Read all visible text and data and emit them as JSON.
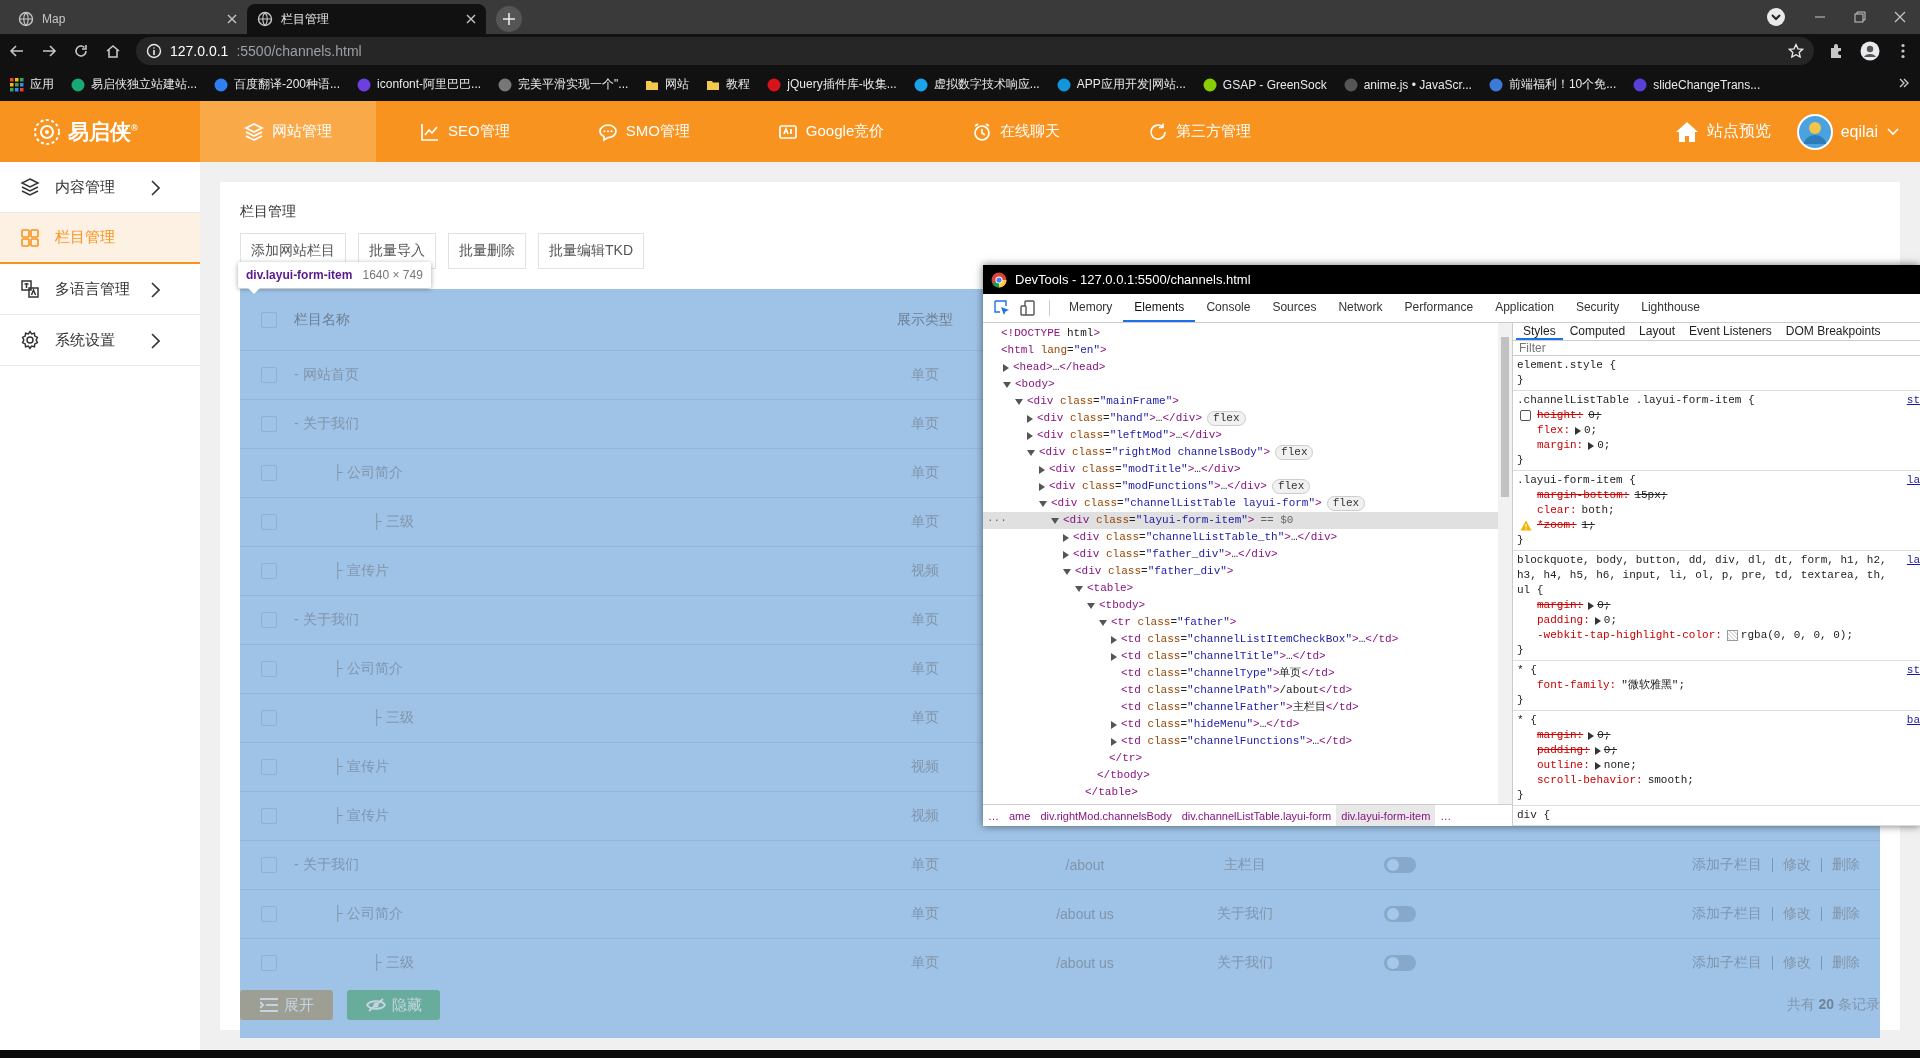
{
  "browser": {
    "tabs": [
      {
        "title": "Map",
        "selected": false
      },
      {
        "title": "栏目管理",
        "selected": true
      }
    ],
    "url_host": "127.0.0.1",
    "url_path": ":5500/channels.html",
    "bookmarks": [
      {
        "label": "应用",
        "kind": "apps"
      },
      {
        "label": "易启侠独立站建站...",
        "kind": "site",
        "color": "#19a974"
      },
      {
        "label": "百度翻译-200种语...",
        "kind": "site",
        "color": "#2f7ff0"
      },
      {
        "label": "iconfont-阿里巴巴...",
        "kind": "site",
        "color": "#6b3fe0"
      },
      {
        "label": "完美平滑实现一个\"...",
        "kind": "site",
        "color": "#777777"
      },
      {
        "label": "网站",
        "kind": "folder"
      },
      {
        "label": "教程",
        "kind": "folder"
      },
      {
        "label": "jQuery插件库-收集...",
        "kind": "site",
        "color": "#d7141a"
      },
      {
        "label": "虚拟数字技术响应...",
        "kind": "site",
        "color": "#1aa3e8"
      },
      {
        "label": "APP应用开发|网站...",
        "kind": "site",
        "color": "#1296db"
      },
      {
        "label": "GSAP - GreenSock",
        "kind": "site",
        "color": "#88ce02"
      },
      {
        "label": "anime.js • JavaScr...",
        "kind": "site",
        "color": "#555555"
      },
      {
        "label": "前端福利！10个免...",
        "kind": "site",
        "color": "#3d7bd8"
      },
      {
        "label": "slideChangeTrans...",
        "kind": "site",
        "color": "#5b3fd9"
      }
    ]
  },
  "header": {
    "logo": "易启侠$^{®}$",
    "nav": [
      {
        "label": "网站管理",
        "selected": true
      },
      {
        "label": "SEO管理",
        "selected": false
      },
      {
        "label": "SMO管理",
        "selected": false
      },
      {
        "label": "Google竞价",
        "selected": false
      },
      {
        "label": "在线聊天",
        "selected": false
      },
      {
        "label": "第三方管理",
        "selected": false
      }
    ],
    "preview": "站点预览",
    "user": "eqilai"
  },
  "sidebar": {
    "items": [
      {
        "label": "内容管理",
        "selected": false,
        "arrow": true
      },
      {
        "label": "栏目管理",
        "selected": true,
        "arrow": false
      },
      {
        "label": "多语言管理",
        "selected": false,
        "arrow": true
      },
      {
        "label": "系统设置",
        "selected": false,
        "arrow": true
      }
    ]
  },
  "page": {
    "title": "栏目管理",
    "buttons": [
      "添加网站栏目",
      "批量导入",
      "批量删除",
      "批量编辑TKD"
    ],
    "header_checked": false,
    "columns": [
      "栏目名称",
      "展示类型"
    ],
    "rows": [
      {
        "title": "- 网站首页",
        "type": "单页",
        "checked": false
      },
      {
        "title": "-  关于我们",
        "type": "单页",
        "checked": false,
        "children": [
          {
            "title": "├ 公司简介",
            "type": "单页",
            "checked": false,
            "children": [
              {
                "title": "├ 三级",
                "type": "单页",
                "checked": false
              }
            ]
          },
          {
            "title": "├ 宣传片",
            "type": "视频",
            "checked": false
          }
        ]
      },
      {
        "title": "-  关于我们",
        "type": "单页",
        "checked": false,
        "children": [
          {
            "title": "├ 公司简介",
            "type": "单页",
            "checked": false,
            "children": [
              {
                "title": "├ 三级",
                "type": "单页",
                "checked": false
              }
            ]
          },
          {
            "title": "├ 宣传片",
            "type": "视频",
            "checked": false
          },
          {
            "title": "├ 宣传片",
            "type": "视频",
            "checked": false
          }
        ]
      },
      {
        "title": "-  关于我们",
        "type": "单页",
        "checked": false,
        "path": "/about",
        "parent": "主栏目",
        "on": false,
        "actions": [
          "添加子栏目",
          "修改",
          "删除"
        ],
        "children": [
          {
            "title": "├ 公司简介",
            "type": "单页",
            "checked": false,
            "path": "/about us",
            "parent": "关于我们",
            "on": false,
            "actions": [
              "添加子栏目",
              "修改",
              "删除"
            ],
            "children": [
              {
                "title": "├ 三级",
                "type": "单页",
                "checked": false,
                "path": "/about us",
                "parent": "关于我们",
                "on": false,
                "actions": [
                  "添加子栏目",
                  "修改",
                  "删除"
                ]
              }
            ]
          }
        ]
      }
    ],
    "footer_buttons": [
      {
        "label": "展开",
        "kind": "expand"
      },
      {
        "label": "隐藏",
        "kind": "hide"
      }
    ],
    "total": "共有 **20** 条记录"
  },
  "inspect_tooltip": {
    "selector": "div.layui-form-item",
    "size": "1640 × 749"
  },
  "devtools": {
    "title": "DevTools - 127.0.0.1:5500/channels.html",
    "tabs": [
      {
        "label": "Memory",
        "selected": false
      },
      {
        "label": "Elements",
        "selected": true
      },
      {
        "label": "Console",
        "selected": false
      },
      {
        "label": "Sources",
        "selected": false
      },
      {
        "label": "Network",
        "selected": false
      },
      {
        "label": "Performance",
        "selected": false
      },
      {
        "label": "Application",
        "selected": false
      },
      {
        "label": "Security",
        "selected": false
      },
      {
        "label": "Lighthouse",
        "selected": false
      }
    ],
    "dom": [
      {
        "text": "<!DOCTYPE html>",
        "kind": "leaf",
        "selected": false
      },
      {
        "text": "<html lang=\"en\">",
        "kind": "leaf",
        "selected": false,
        "children": [
          {
            "text": "<head>…</head>",
            "kind": "collapsed",
            "selected": false
          },
          {
            "text": "<body>",
            "kind": "expanded",
            "selected": false,
            "children": [
              {
                "text": "<div class=\"mainFrame\">",
                "kind": "expanded",
                "selected": false,
                "children": [
                  {
                    "text": "<div class=\"hand\">…</div>",
                    "kind": "collapsed",
                    "selected": false,
                    "badge": "flex"
                  },
                  {
                    "text": "<div class=\"leftMod\">…</div>",
                    "kind": "collapsed",
                    "selected": false
                  },
                  {
                    "text": "<div class=\"rightMod channelsBody\">",
                    "kind": "expanded",
                    "selected": false,
                    "badge": "flex",
                    "children": [
                      {
                        "text": "<div class=\"modTitle\">…</div>",
                        "kind": "collapsed",
                        "selected": false
                      },
                      {
                        "text": "<div class=\"modFunctions\">…</div>",
                        "kind": "collapsed",
                        "selected": false,
                        "badge": "flex"
                      },
                      {
                        "text": "<div class=\"channelListTable layui-form\">",
                        "kind": "expanded",
                        "selected": false,
                        "badge": "flex",
                        "children": [
                          {
                            "text": "<div class=\"layui-form-item\">",
                            "kind": "expanded",
                            "selected": true,
                            "marker": "== $0",
                            "gutter": "···",
                            "children": [
                              {
                                "text": "<div class=\"channelListTable_th\">…</div>",
                                "kind": "collapsed",
                                "selected": false
                              },
                              {
                                "text": "<div class=\"father_div\">…</div>",
                                "kind": "collapsed",
                                "selected": false
                              },
                              {
                                "text": "<div class=\"father_div\">",
                                "kind": "expanded",
                                "selected": false,
                                "children": [
                                  {
                                    "text": "<table>",
                                    "kind": "expanded",
                                    "selected": false,
                                    "close": "</table>",
                                    "children": [
                                      {
                                        "text": "<tbody>",
                                        "kind": "expanded",
                                        "selected": false,
                                        "close": "</tbody>",
                                        "children": [
                                          {
                                            "text": "<tr class=\"father\">",
                                            "kind": "expanded",
                                            "selected": false,
                                            "close": "</tr>",
                                            "children": [
                                              {
                                                "text": "<td class=\"channelListItemCheckBox\">…</td>",
                                                "kind": "collapsed",
                                                "selected": false
                                              },
                                              {
                                                "text": "<td class=\"channelTitle\">…</td>",
                                                "kind": "collapsed",
                                                "selected": false
                                              },
                                              {
                                                "text": "<td class=\"channelType\">单页</td>",
                                                "kind": "leaf",
                                                "selected": false
                                              },
                                              {
                                                "text": "<td class=\"channelPath\">/about</td>",
                                                "kind": "leaf",
                                                "selected": false
                                              },
                                              {
                                                "text": "<td class=\"channelFather\">主栏目</td>",
                                                "kind": "leaf",
                                                "selected": false
                                              },
                                              {
                                                "text": "<td class=\"hideMenu\">…</td>",
                                                "kind": "collapsed",
                                                "selected": false
                                              },
                                              {
                                                "text": "<td class=\"channelFunctions\">…</td>",
                                                "kind": "collapsed",
                                                "selected": false
                                              }
                                            ]
                                          }
                                        ]
                                      }
                                    ]
                                  }
                                ]
                              }
                            ]
                          }
                        ]
                      }
                    ]
                  }
                ]
              }
            ]
          }
        ]
      }
    ],
    "breadcrumbs": [
      {
        "label": "…",
        "selected": false
      },
      {
        "label": "ame",
        "selected": false
      },
      {
        "label": "div.rightMod.channelsBody",
        "selected": false
      },
      {
        "label": "div.channelListTable.layui-form",
        "selected": false
      },
      {
        "label": "div.layui-form-item",
        "selected": true
      },
      {
        "label": "…",
        "selected": false
      }
    ],
    "style_tabs": [
      {
        "label": "Styles",
        "selected": true
      },
      {
        "label": "Computed",
        "selected": false
      },
      {
        "label": "Layout",
        "selected": false
      },
      {
        "label": "Event Listeners",
        "selected": false
      },
      {
        "label": "DOM Breakpoints",
        "selected": false
      }
    ],
    "filter_placeholder": "Filter",
    "rules": [
      {
        "selector": "element.style {",
        "close": "}"
      },
      {
        "selector": ".channelListTable .layui-form-item {",
        "source": "st",
        "close": "}",
        "decls": [
          {
            "name": "height:",
            "value": "0;",
            "struck": true,
            "expandable": false,
            "kind": "checkbox"
          },
          {
            "name": "flex:",
            "value": "0;",
            "struck": false,
            "expandable": true,
            "kind": "plain"
          },
          {
            "name": "margin:",
            "value": "0;",
            "struck": false,
            "expandable": true,
            "kind": "plain"
          }
        ]
      },
      {
        "selector": ".layui-form-item {",
        "source": "la",
        "close": "}",
        "decls": [
          {
            "name": "margin-bottom:",
            "value": "15px;",
            "struck": true,
            "expandable": false,
            "kind": "plain"
          },
          {
            "name": "clear:",
            "value": "both;",
            "struck": false,
            "expandable": false,
            "kind": "plain"
          },
          {
            "name": "*zoom:",
            "value": "1;",
            "struck": true,
            "expandable": false,
            "kind": "warning"
          }
        ]
      },
      {
        "selector": "blockquote, body, button, dd, div, dl, dt, form, h1, h2, h3, h4, h5, h6, input, li, ol, p, pre, td, textarea, th, ul {",
        "source": "la",
        "close": "}",
        "decls": [
          {
            "name": "margin:",
            "value": "0;",
            "struck": true,
            "expandable": true,
            "kind": "plain"
          },
          {
            "name": "padding:",
            "value": "0;",
            "struck": false,
            "expandable": true,
            "kind": "plain"
          },
          {
            "name": "-webkit-tap-highlight-color:",
            "value": "rgba(0, 0, 0, 0);",
            "struck": false,
            "expandable": false,
            "kind": "color"
          }
        ]
      },
      {
        "selector": "* {",
        "source": "st",
        "close": "}",
        "decls": [
          {
            "name": "font-family:",
            "value": "\"微软雅黑\";",
            "struck": false,
            "expandable": false,
            "kind": "plain"
          }
        ]
      },
      {
        "selector": "* {",
        "source": "ba",
        "close": "}",
        "decls": [
          {
            "name": "margin:",
            "value": "0;",
            "struck": true,
            "expandable": true,
            "kind": "plain"
          },
          {
            "name": "padding:",
            "value": "0;",
            "struck": true,
            "expandable": true,
            "kind": "plain"
          },
          {
            "name": "outline:",
            "value": "none;",
            "struck": false,
            "expandable": true,
            "kind": "plain"
          },
          {
            "name": "scroll-behavior:",
            "value": "smooth;",
            "struck": false,
            "expandable": false,
            "kind": "plain"
          }
        ]
      },
      {
        "selector": "div {"
      }
    ]
  }
}
